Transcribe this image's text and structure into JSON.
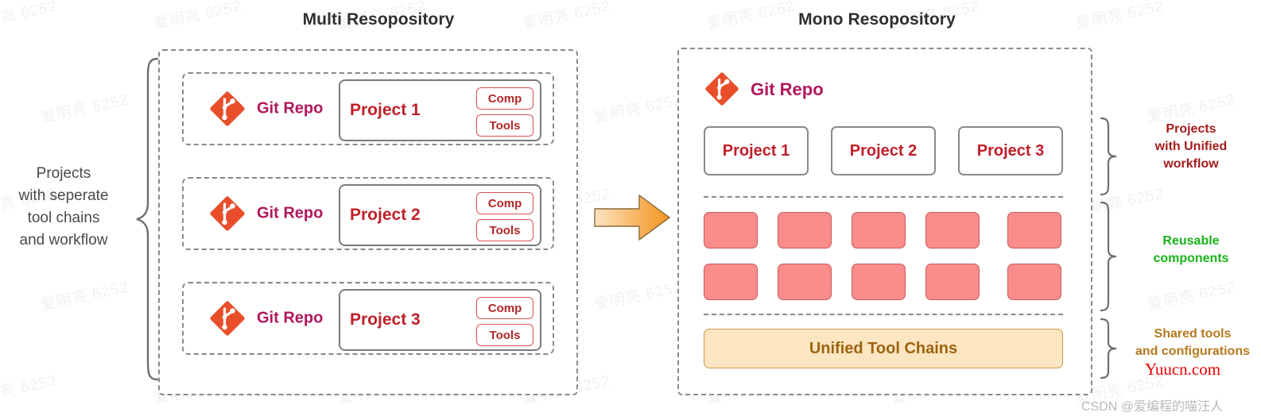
{
  "left_panel": {
    "title": "Multi Resopository",
    "caption": "Projects\nwith seperate\ntool chains\nand workflow",
    "caption_lines": [
      "Projects",
      "with seperate",
      "tool chains",
      "and workflow"
    ],
    "repos": [
      {
        "git_label": "Git Repo",
        "project": "Project 1",
        "tags": [
          "Comp",
          "Tools"
        ]
      },
      {
        "git_label": "Git Repo",
        "project": "Project 2",
        "tags": [
          "Comp",
          "Tools"
        ]
      },
      {
        "git_label": "Git Repo",
        "project": "Project 3",
        "tags": [
          "Comp",
          "Tools"
        ]
      }
    ]
  },
  "arrow": {
    "icon": "right-arrow-icon",
    "color": "#F5A council"
  },
  "right_panel": {
    "title": "Mono Resopository",
    "git_label": "Git Repo",
    "projects": [
      "Project 1",
      "Project 2",
      "Project 3"
    ],
    "components_rows": 2,
    "components_per_row": 5,
    "tool_chains_label": "Unified Tool Chains",
    "annotations": [
      {
        "lines": [
          "Projects",
          "with Unified",
          "workflow"
        ],
        "color": "#a51c1c"
      },
      {
        "lines": [
          "Reusable",
          "components"
        ],
        "color": "#19b319"
      },
      {
        "lines": [
          "Shared tools",
          "and configurations"
        ],
        "color": "#b5791f"
      }
    ]
  },
  "watermarks": {
    "site": "Yuucn.com",
    "credit": "CSDN @爱编程的喵汪人",
    "bg_text": "爱明亮 6252"
  },
  "colors": {
    "git_orange": "#E94E2B",
    "git_label": "#b0185c",
    "project_red": "#c0202a",
    "component_tile": "#FA8C8C",
    "toolchain_bg": "#FCE5C1",
    "toolchain_text": "#9c6310",
    "dash_gray": "#8a8a8a",
    "arrow_orange": "#F5A33C"
  }
}
